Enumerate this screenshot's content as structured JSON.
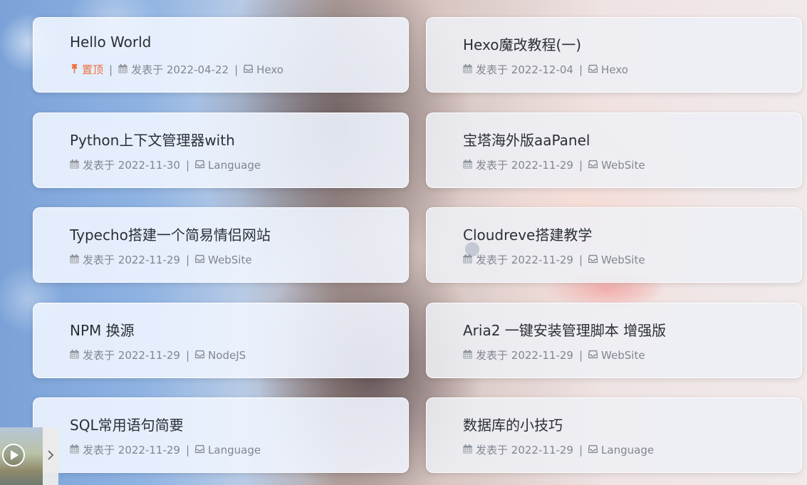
{
  "posts": [
    {
      "title": "Hello World",
      "pinned": true,
      "pinned_label": "置顶",
      "date_prefix": "发表于",
      "date": "2022-04-22",
      "category": "Hexo"
    },
    {
      "title": "Hexo魔改教程(一)",
      "pinned": false,
      "date_prefix": "发表于",
      "date": "2022-12-04",
      "category": "Hexo"
    },
    {
      "title": "Python上下文管理器with",
      "pinned": false,
      "date_prefix": "发表于",
      "date": "2022-11-30",
      "category": "Language"
    },
    {
      "title": "宝塔海外版aaPanel",
      "pinned": false,
      "date_prefix": "发表于",
      "date": "2022-11-29",
      "category": "WebSite"
    },
    {
      "title": "Typecho搭建一个简易情侣网站",
      "pinned": false,
      "date_prefix": "发表于",
      "date": "2022-11-29",
      "category": "WebSite"
    },
    {
      "title": "Cloudreve搭建教学",
      "pinned": false,
      "date_prefix": "发表于",
      "date": "2022-11-29",
      "category": "WebSite"
    },
    {
      "title": "NPM 换源",
      "pinned": false,
      "date_prefix": "发表于",
      "date": "2022-11-29",
      "category": "NodeJS"
    },
    {
      "title": "Aria2 一键安装管理脚本 增强版",
      "pinned": false,
      "date_prefix": "发表于",
      "date": "2022-11-29",
      "category": "WebSite"
    },
    {
      "title": "SQL常用语句简要",
      "pinned": false,
      "date_prefix": "发表于",
      "date": "2022-11-29",
      "category": "Language"
    },
    {
      "title": "数据库的小技巧",
      "pinned": false,
      "date_prefix": "发表于",
      "date": "2022-11-29",
      "category": "Language"
    }
  ],
  "separator": "|",
  "colors": {
    "pin_accent": "#f07040",
    "meta_text": "#818790",
    "title_text": "#2b2f36"
  },
  "icons": {
    "pin": "thumbtack-icon",
    "date": "calendar-icon",
    "category": "inbox-icon",
    "player_play": "play-circle-icon",
    "player_toggle": "chevron-right-icon"
  }
}
